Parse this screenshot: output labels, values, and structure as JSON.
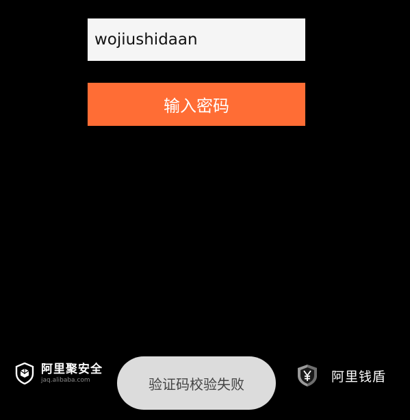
{
  "form": {
    "account_value": "wojiushidaan",
    "submit_label": "输入密码"
  },
  "footer": {
    "left_brand": {
      "name": "阿里聚安全",
      "url_text": "jaq.alibaba.com",
      "icon": "security-shield-icon"
    },
    "right_brand": {
      "name": "阿里钱盾",
      "icon": "money-shield-icon"
    }
  },
  "toast": {
    "message": "验证码校验失败"
  },
  "colors": {
    "background": "#000000",
    "input_bg": "#f5f5f5",
    "accent": "#ff6d35",
    "toast_bg": "#dcdcdc"
  }
}
